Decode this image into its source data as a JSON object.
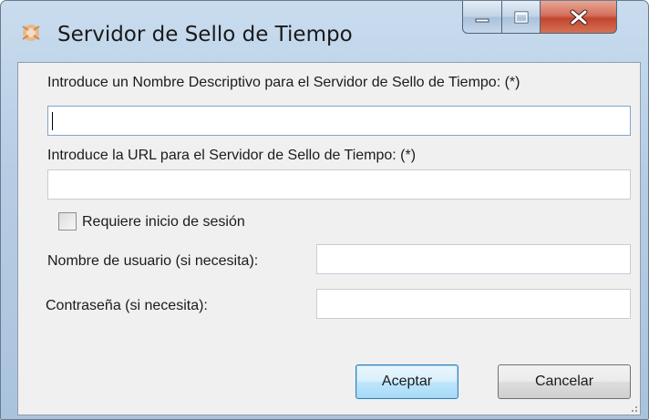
{
  "window": {
    "title": "Servidor de Sello de Tiempo",
    "icon": "certificate-seal-icon"
  },
  "form": {
    "name_label": "Introduce un Nombre Descriptivo para el Servidor de Sello de Tiempo: (*)",
    "name_value": "",
    "url_label": "Introduce la URL para el Servidor de Sello de Tiempo: (*)",
    "url_value": "",
    "requires_login_label": "Requiere inicio de sesión",
    "requires_login_checked": false,
    "username_label": "Nombre de usuario (si necesita):",
    "username_value": "",
    "password_label": "Contraseña (si necesita):",
    "password_value": ""
  },
  "buttons": {
    "accept": "Aceptar",
    "cancel": "Cancelar"
  },
  "colors": {
    "accent": "#3c7fb1",
    "close": "#c2462e",
    "frame": "#b7cde4"
  }
}
